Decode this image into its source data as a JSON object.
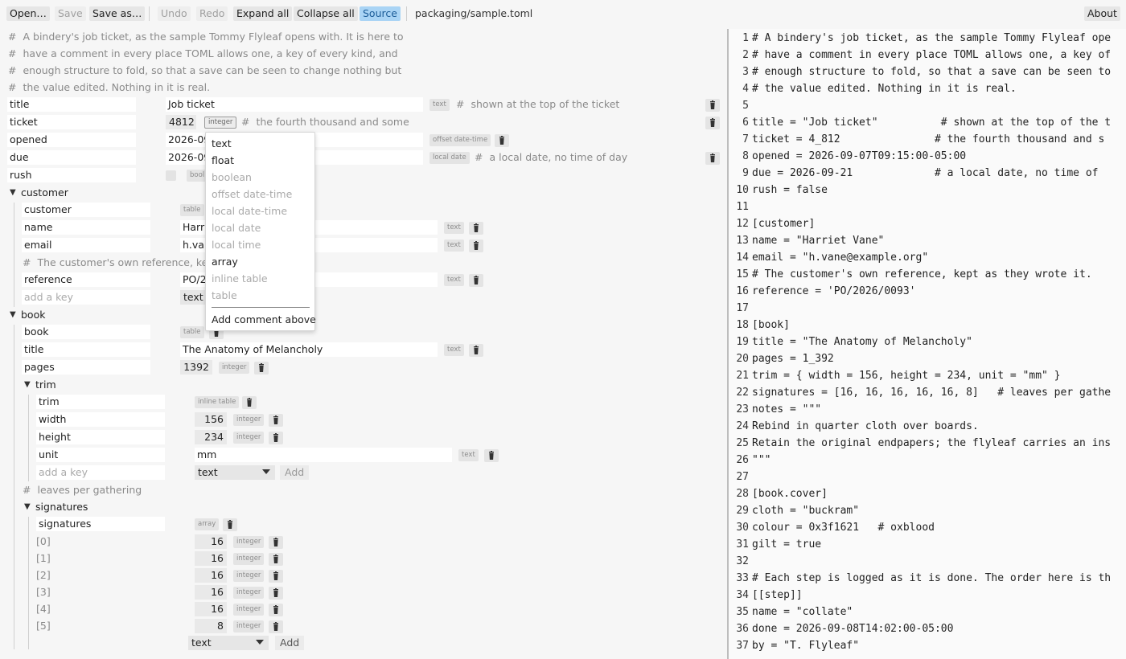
{
  "toolbar": {
    "open": "Open…",
    "save": "Save",
    "save_as": "Save as…",
    "undo": "Undo",
    "redo": "Redo",
    "expand_all": "Expand all",
    "collapse_all": "Collapse all",
    "source": "Source",
    "file_path": "packaging/sample.toml",
    "about": "About"
  },
  "header_comments": [
    "A bindery's job ticket, as the sample Tommy Flyleaf opens with. It is here to",
    "have a comment in every place TOML allows one, a key of every kind, and",
    "enough structure to fold, so that a save can be seen to change nothing but",
    "the value edited. Nothing in it is real."
  ],
  "root": {
    "title": {
      "key": "title",
      "value": "Job ticket",
      "type": "text",
      "comment": "shown at the top of the ticket"
    },
    "ticket": {
      "key": "ticket",
      "value": "4812",
      "type": "integer",
      "comment": "the fourth thousand and some"
    },
    "opened": {
      "key": "opened",
      "value": "2026-09",
      "type": "offset date-time"
    },
    "due": {
      "key": "due",
      "value": "2026-09",
      "type": "local date",
      "comment": "a local date, no time of day"
    },
    "rush": {
      "key": "rush",
      "type": "bool"
    }
  },
  "customer": {
    "label": "customer",
    "self_key": "customer",
    "self_type": "table",
    "name": {
      "key": "name",
      "value": "Harr",
      "type": "text"
    },
    "email": {
      "key": "email",
      "value": "h.van",
      "type": "text"
    },
    "comment": "The customer's own reference, kept",
    "reference": {
      "key": "reference",
      "value": "PO/2",
      "type": "text"
    },
    "add_placeholder": "add a key",
    "add_type": "text"
  },
  "book": {
    "label": "book",
    "self_key": "book",
    "self_type": "table",
    "title": {
      "key": "title",
      "value": "The Anatomy of Melancholy",
      "type": "text"
    },
    "pages": {
      "key": "pages",
      "value": "1392",
      "type": "integer"
    },
    "trim": {
      "label": "trim",
      "self_key": "trim",
      "self_type": "inline table",
      "width": {
        "key": "width",
        "value": "156",
        "type": "integer"
      },
      "height": {
        "key": "height",
        "value": "234",
        "type": "integer"
      },
      "unit": {
        "key": "unit",
        "value": "mm",
        "type": "text"
      },
      "add_placeholder": "add a key",
      "add_type": "text",
      "add_label": "Add"
    },
    "signatures_comment": "leaves per gathering",
    "signatures": {
      "label": "signatures",
      "self_key": "signatures",
      "self_type": "array",
      "items": [
        {
          "idx": "[0]",
          "value": "16",
          "type": "integer"
        },
        {
          "idx": "[1]",
          "value": "16",
          "type": "integer"
        },
        {
          "idx": "[2]",
          "value": "16",
          "type": "integer"
        },
        {
          "idx": "[3]",
          "value": "16",
          "type": "integer"
        },
        {
          "idx": "[4]",
          "value": "16",
          "type": "integer"
        },
        {
          "idx": "[5]",
          "value": "8",
          "type": "integer"
        }
      ],
      "add_type": "text",
      "add_label": "Add"
    }
  },
  "type_menu": {
    "items": [
      {
        "label": "text",
        "enabled": true
      },
      {
        "label": "float",
        "enabled": true
      },
      {
        "label": "boolean",
        "enabled": false
      },
      {
        "label": "offset date-time",
        "enabled": false
      },
      {
        "label": "local date-time",
        "enabled": false
      },
      {
        "label": "local date",
        "enabled": false
      },
      {
        "label": "local time",
        "enabled": false
      },
      {
        "label": "array",
        "enabled": true
      },
      {
        "label": "inline table",
        "enabled": false
      },
      {
        "label": "table",
        "enabled": false
      }
    ],
    "add_comment": "Add comment above"
  },
  "source_lines": [
    "# A bindery's job ticket, as the sample Tommy Flyleaf ope",
    "# have a comment in every place TOML allows one, a key of",
    "# enough structure to fold, so that a save can be seen to",
    "# the value edited. Nothing in it is real.",
    "",
    "title = \"Job ticket\"          # shown at the top of the t",
    "ticket = 4_812               # the fourth thousand and s",
    "opened = 2026-09-07T09:15:00-05:00",
    "due = 2026-09-21             # a local date, no time of",
    "rush = false",
    "",
    "[customer]",
    "name = \"Harriet Vane\"",
    "email = \"h.vane@example.org\"",
    "# The customer's own reference, kept as they wrote it.",
    "reference = 'PO/2026/0093'",
    "",
    "[book]",
    "title = \"The Anatomy of Melancholy\"",
    "pages = 1_392",
    "trim = { width = 156, height = 234, unit = \"mm\" }",
    "signatures = [16, 16, 16, 16, 16, 8]   # leaves per gathe",
    "notes = \"\"\"",
    "Rebind in quarter cloth over boards.",
    "Retain the original endpapers; the flyleaf carries an ins",
    "\"\"\"",
    "",
    "[book.cover]",
    "cloth = \"buckram\"",
    "colour = 0x3f1621   # oxblood",
    "gilt = true",
    "",
    "# Each step is logged as it is done. The order here is th",
    "[[step]]",
    "name = \"collate\"",
    "done = 2026-09-08T14:02:00-05:00",
    "by = \"T. Flyleaf\""
  ]
}
